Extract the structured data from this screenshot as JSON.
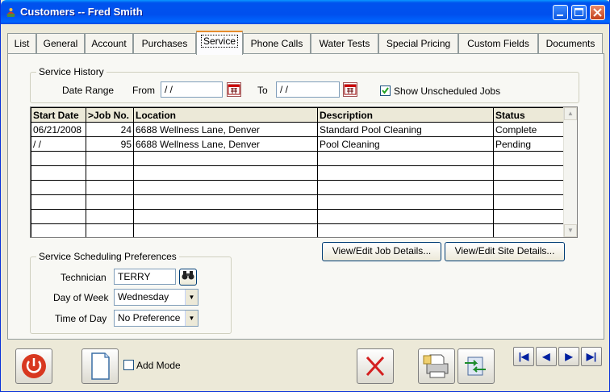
{
  "window": {
    "title": "Customers -- Fred Smith"
  },
  "tabs": [
    {
      "label": "List"
    },
    {
      "label": "General"
    },
    {
      "label": "Account"
    },
    {
      "label": "Purchases"
    },
    {
      "label": "Service"
    },
    {
      "label": "Phone Calls"
    },
    {
      "label": "Water Tests"
    },
    {
      "label": "Special Pricing"
    },
    {
      "label": "Custom Fields"
    },
    {
      "label": "Documents"
    }
  ],
  "active_tab": "Service",
  "history": {
    "legend": "Service History",
    "date_range_label": "Date Range",
    "from_label": "From",
    "from_value": " / /",
    "to_label": "To",
    "to_value": " / /",
    "show_unscheduled_label": "Show Unscheduled Jobs",
    "show_unscheduled_checked": true,
    "columns": [
      "Start Date",
      ">Job No.",
      "Location",
      "Description",
      "Status"
    ],
    "rows": [
      {
        "start_date": "06/21/2008",
        "job_no": "24",
        "location": "6688 Wellness Lane, Denver",
        "description": "Standard Pool Cleaning",
        "status": "Complete"
      },
      {
        "start_date": " / /",
        "job_no": "95",
        "location": "6688 Wellness Lane, Denver",
        "description": "Pool Cleaning",
        "status": "Pending"
      }
    ],
    "view_job_label": "View/Edit Job Details...",
    "view_site_label": "View/Edit Site Details..."
  },
  "prefs": {
    "legend": "Service Scheduling Preferences",
    "technician_label": "Technician",
    "technician_value": "TERRY",
    "dow_label": "Day of Week",
    "dow_value": "Wednesday",
    "tod_label": "Time of Day",
    "tod_value": "No Preference"
  },
  "bottom": {
    "add_mode_label": "Add Mode",
    "add_mode_checked": false
  },
  "colors": {
    "titlebar": "#0054e3",
    "tab_highlight": "#e68b2c",
    "delete_x": "#d42020",
    "power": "#d83820"
  }
}
